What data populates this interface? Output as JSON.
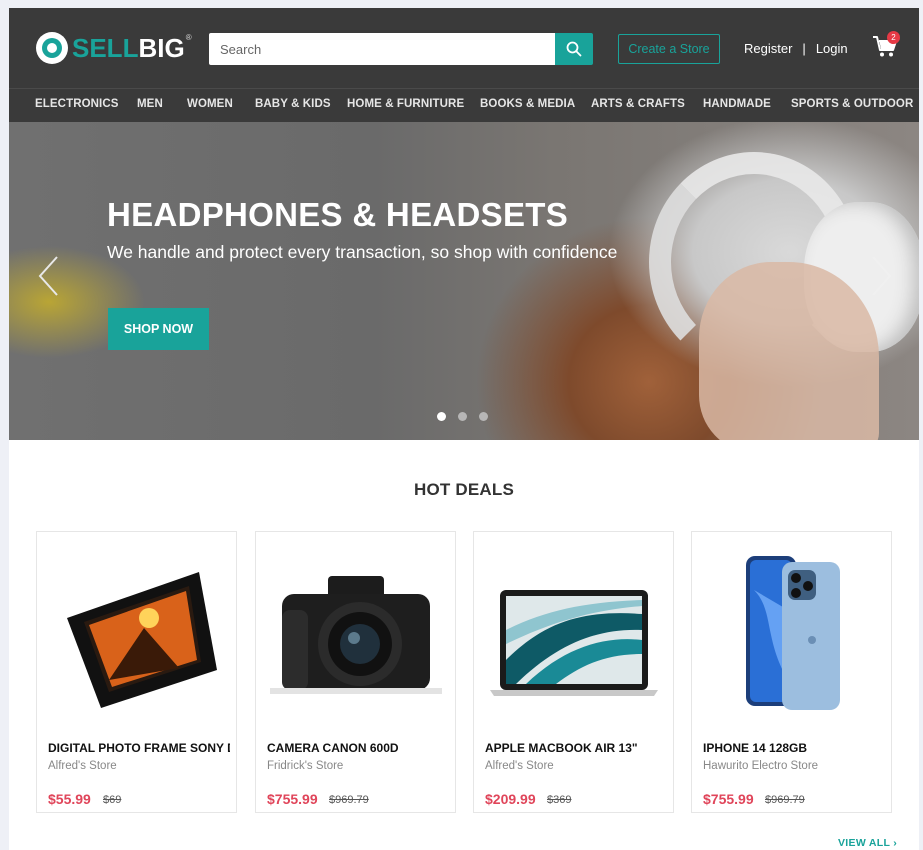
{
  "brand": {
    "sell": "SELL",
    "big": "BIG",
    "reg": "®"
  },
  "header": {
    "search_placeholder": "Search",
    "create_store": "Create a Store",
    "register": "Register",
    "separator": "|",
    "login": "Login",
    "cart_count": "2"
  },
  "nav": {
    "items": [
      "ELECTRONICS",
      "MEN",
      "WOMEN",
      "BABY & KIDS",
      "HOME & FURNITURE",
      "BOOKS & MEDIA",
      "ARTS & CRAFTS",
      "HANDMADE",
      "SPORTS & OUTDOOR"
    ]
  },
  "hero": {
    "title": "HEADPHONES & HEADSETS",
    "subtitle": "We handle and protect every transaction, so shop with confidence",
    "cta": "SHOP NOW",
    "slides": 3,
    "active_slide": 1
  },
  "deals": {
    "title": "HOT DEALS",
    "products": [
      {
        "name": "DIGITAL PHOTO FRAME SONY DI...",
        "store": "Alfred's Store",
        "price": "$55.99",
        "old_price": "$69",
        "image": "photo-frame-image"
      },
      {
        "name": "CAMERA CANON 600D",
        "store": "Fridrick's Store",
        "price": "$755.99",
        "old_price": "$969.79",
        "image": "camera-image"
      },
      {
        "name": "APPLE MACBOOK AIR 13\"",
        "store": "Alfred's Store",
        "price": "$209.99",
        "old_price": "$369",
        "image": "laptop-image"
      },
      {
        "name": "IPHONE 14 128GB",
        "store": "Hawurito Electro Store",
        "price": "$755.99",
        "old_price": "$969.79",
        "image": "phone-image"
      }
    ],
    "view_all": "VIEW ALL ›"
  },
  "colors": {
    "accent": "#19a39a",
    "header_bg": "#3a3a3a",
    "price": "#e0455a"
  }
}
